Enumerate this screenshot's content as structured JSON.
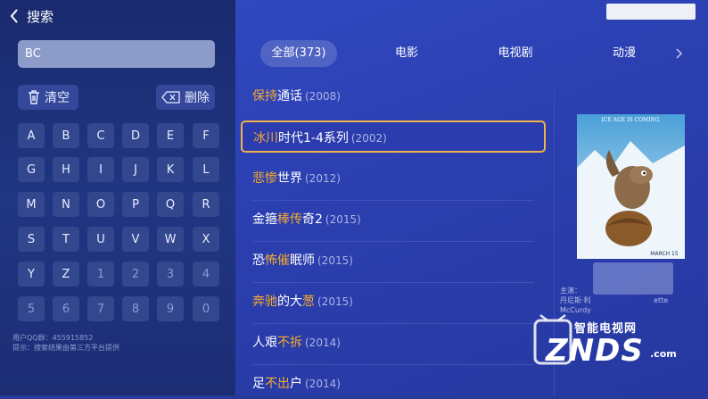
{
  "header": {
    "title": "搜索"
  },
  "search": {
    "value": "BC"
  },
  "actions": {
    "clear_label": "清空",
    "delete_label": "删除"
  },
  "keyboard": {
    "rows": [
      [
        "A",
        "B",
        "C",
        "D",
        "E",
        "F"
      ],
      [
        "G",
        "H",
        "I",
        "J",
        "K",
        "L"
      ],
      [
        "M",
        "N",
        "O",
        "P",
        "Q",
        "R"
      ],
      [
        "S",
        "T",
        "U",
        "V",
        "W",
        "X"
      ],
      [
        "Y",
        "Z",
        "1",
        "2",
        "3",
        "4"
      ],
      [
        "5",
        "6",
        "7",
        "8",
        "9",
        "0"
      ]
    ]
  },
  "notes": {
    "qq": "用户QQ群：455915852",
    "hint": "提示：搜索结果由第三方平台提供"
  },
  "tabs": [
    {
      "label": "全部(373)",
      "active": true
    },
    {
      "label": "电影",
      "active": false
    },
    {
      "label": "电视剧",
      "active": false
    },
    {
      "label": "动漫",
      "active": false
    }
  ],
  "results": [
    {
      "parts": [
        {
          "t": "保持",
          "h": true
        },
        {
          "t": "通话",
          "h": false
        }
      ],
      "year": "(2008)"
    },
    {
      "parts": [
        {
          "t": "冰川",
          "h": true
        },
        {
          "t": "时代1-4系列",
          "h": false
        }
      ],
      "year": "(2002)",
      "selected": true
    },
    {
      "parts": [
        {
          "t": "悲惨",
          "h": true
        },
        {
          "t": "世界",
          "h": false
        }
      ],
      "year": "(2012)"
    },
    {
      "parts": [
        {
          "t": "金箍",
          "h": false
        },
        {
          "t": "棒传",
          "h": true
        },
        {
          "t": "奇2",
          "h": false
        }
      ],
      "year": "(2015)"
    },
    {
      "parts": [
        {
          "t": "恐",
          "h": false
        },
        {
          "t": "怖催",
          "h": true
        },
        {
          "t": "眠师",
          "h": false
        }
      ],
      "year": "(2015)"
    },
    {
      "parts": [
        {
          "t": "奔驰",
          "h": true
        },
        {
          "t": "的大",
          "h": false
        },
        {
          "t": "葱",
          "h": true
        }
      ],
      "year": "(2015)"
    },
    {
      "parts": [
        {
          "t": "人艰",
          "h": false
        },
        {
          "t": "不拆",
          "h": true
        }
      ],
      "year": "(2014)"
    },
    {
      "parts": [
        {
          "t": "足",
          "h": false
        },
        {
          "t": "不出",
          "h": true
        },
        {
          "t": "户",
          "h": false
        }
      ],
      "year": "(2014)"
    }
  ],
  "detail": {
    "poster_top_text": "ICE AGE IS COMING",
    "poster_date": "MARCH 15",
    "cast_label": "主演：",
    "cast_line2": "丹尼斯·利",
    "cast_line2b": "ette",
    "cast_line3": "McCurdy"
  },
  "watermark": {
    "brand": "智能电视网",
    "logo": "ZNDS",
    "suffix": ".com"
  },
  "colors": {
    "highlight": "#f5a930",
    "selected_border": "#f2b24a"
  }
}
